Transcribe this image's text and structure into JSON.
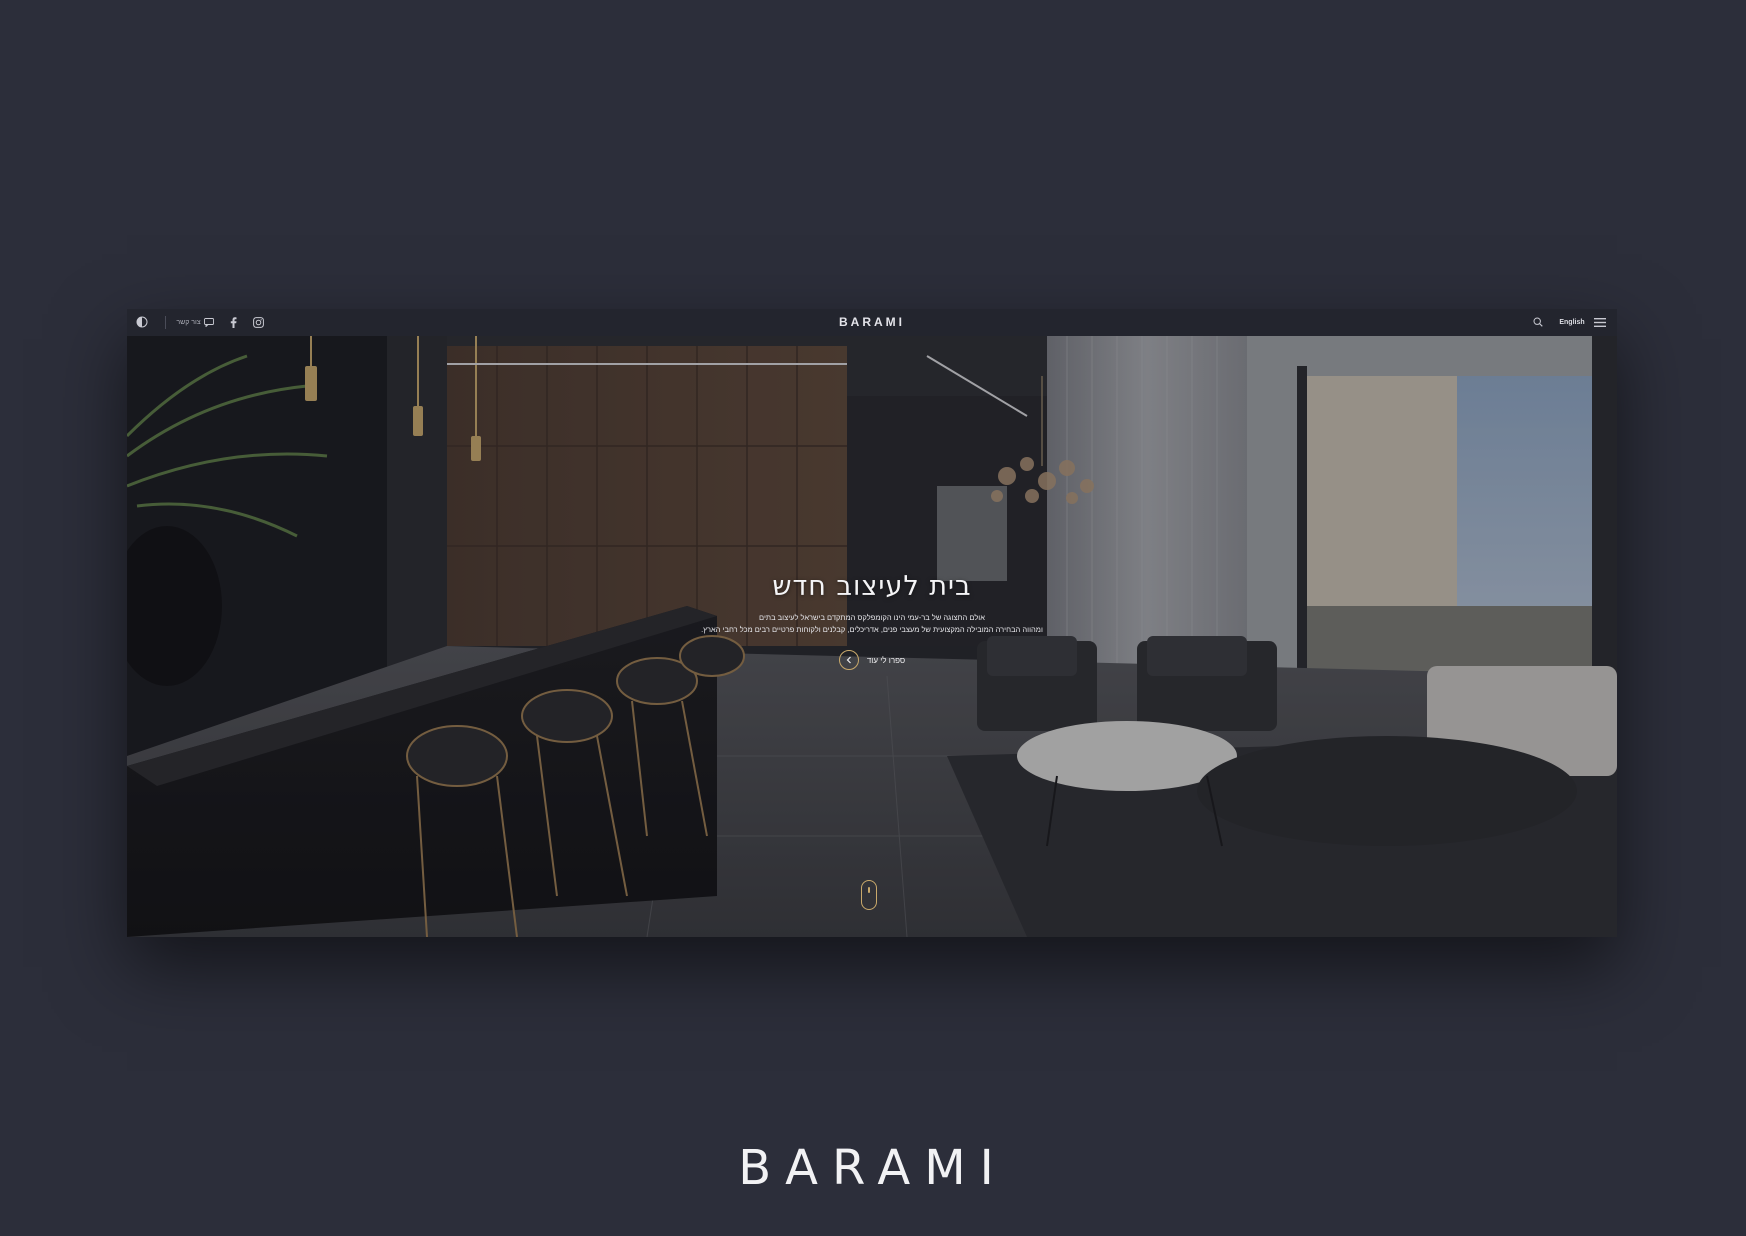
{
  "mockup": {
    "topbar": {
      "logo": "BARAMI",
      "left_icons": [
        {
          "name": "accessibility-icon"
        },
        {
          "name": "chat-icon",
          "label": "צור קשר"
        },
        {
          "name": "facebook-icon"
        },
        {
          "name": "instagram-icon"
        }
      ],
      "right_items": {
        "search_icon": "search-icon",
        "language_label": "English",
        "menu_icon": "hamburger-menu-icon"
      }
    },
    "hero": {
      "title": "בית לעיצוב חדש",
      "description_line1": "אולם התצוגה של בר-עמי הינו הקומפלקס המתקדם בישראל לעיצוב בתים",
      "description_line2": "ומהווה הבחירה המובילה המקצועית של מעצבי פנים, אדריכלים, קבלנים ולקוחות פרטיים רבים מכל רחבי הארץ.",
      "cta_label": "ספרו לי עוד",
      "cta_icon": "chevron-left-icon",
      "scroll_icon": "scroll-mouse-icon"
    }
  },
  "brand_footer": {
    "logo": "BARAMI"
  },
  "colors": {
    "background": "#2c2e3a",
    "accent_gold": "#c9a96b",
    "topbar": "#23252e"
  }
}
